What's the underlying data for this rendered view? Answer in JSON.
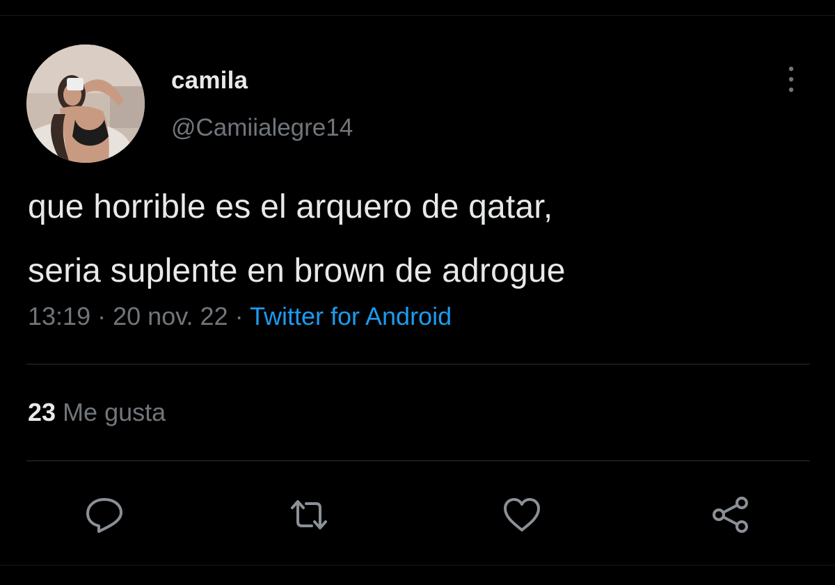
{
  "tweet": {
    "author": {
      "display_name": "camila",
      "handle": "@Camiialegre14"
    },
    "text_lines": [
      "que horrible es el arquero de qatar,",
      "seria suplente en brown de adrogue"
    ],
    "time": "13:19",
    "separator": "·",
    "date": "20 nov. 22",
    "source": "Twitter for Android",
    "likes": {
      "count": "23",
      "label": "Me gusta"
    }
  },
  "actions": {
    "reply_icon": "reply-icon",
    "retweet_icon": "retweet-icon",
    "like_icon": "heart-icon",
    "share_icon": "share-icon",
    "more_icon": "more-vertical-icon"
  },
  "colors": {
    "background": "#000000",
    "primary_text": "#e7e9ea",
    "secondary_text": "#71767b",
    "link": "#1d9bf0",
    "divider": "#2a2e32"
  }
}
